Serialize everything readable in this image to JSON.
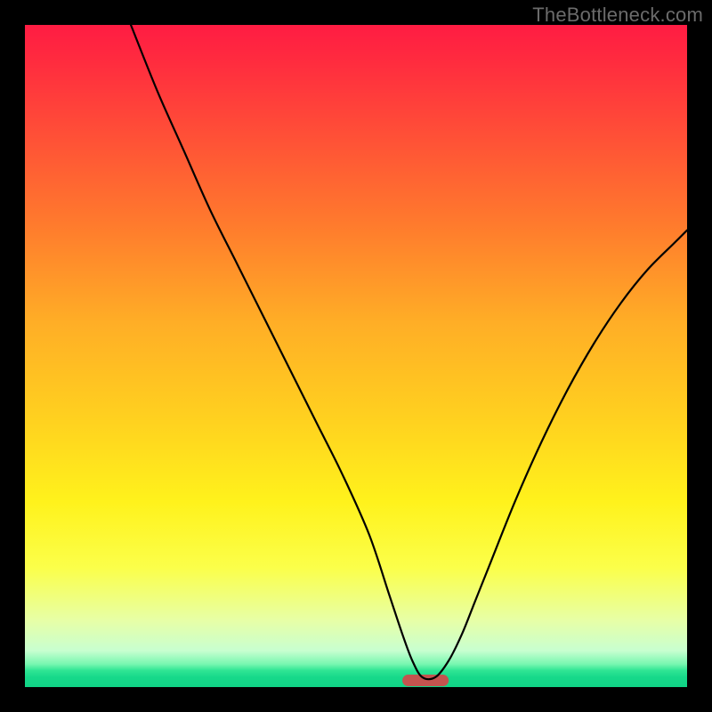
{
  "watermark": "TheBottleneck.com",
  "chart_data": {
    "type": "line",
    "title": "",
    "xlabel": "",
    "ylabel": "",
    "xlim": [
      0,
      100
    ],
    "ylim": [
      0,
      100
    ],
    "grid": false,
    "legend": false,
    "series": [
      {
        "name": "curve",
        "x": [
          16,
          20,
          24,
          28,
          32,
          36,
          40,
          44,
          48,
          52,
          55,
          57,
          58.5,
          60,
          62,
          64,
          66,
          68,
          70,
          74,
          78,
          82,
          86,
          90,
          94,
          98,
          100
        ],
        "y": [
          100,
          90,
          81,
          72,
          64,
          56,
          48,
          40,
          32,
          23,
          14,
          8,
          4,
          1.5,
          1.5,
          4,
          8,
          13,
          18,
          28,
          37,
          45,
          52,
          58,
          63,
          67,
          69
        ]
      }
    ],
    "markers": [
      {
        "name": "optimum-bar",
        "x0": 57,
        "x1": 64,
        "y": 1.0,
        "color": "#c4544f"
      }
    ],
    "gradient_stops": [
      {
        "offset": 0.0,
        "color": "#ff1c43"
      },
      {
        "offset": 0.05,
        "color": "#ff2a3f"
      },
      {
        "offset": 0.15,
        "color": "#ff4a38"
      },
      {
        "offset": 0.3,
        "color": "#ff7a2d"
      },
      {
        "offset": 0.45,
        "color": "#ffae26"
      },
      {
        "offset": 0.6,
        "color": "#ffd21f"
      },
      {
        "offset": 0.72,
        "color": "#fff21c"
      },
      {
        "offset": 0.82,
        "color": "#fbff4a"
      },
      {
        "offset": 0.9,
        "color": "#e7ffa7"
      },
      {
        "offset": 0.945,
        "color": "#c8ffd0"
      },
      {
        "offset": 0.965,
        "color": "#79f7b1"
      },
      {
        "offset": 0.975,
        "color": "#2fe594"
      },
      {
        "offset": 0.985,
        "color": "#17d98a"
      },
      {
        "offset": 1.0,
        "color": "#10d486"
      }
    ]
  }
}
